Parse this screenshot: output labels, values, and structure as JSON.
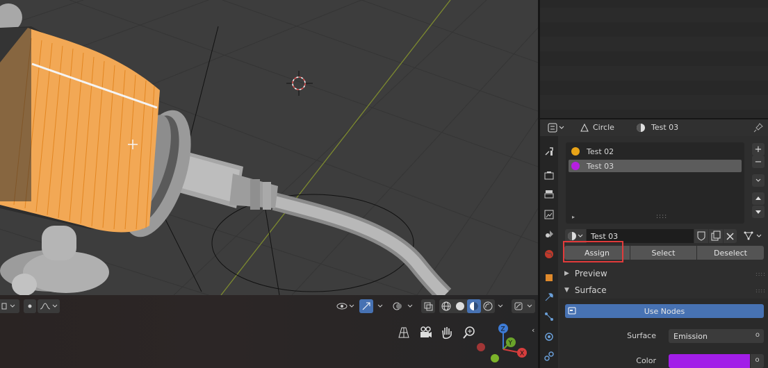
{
  "colors": {
    "viewport_bg": "#3d3d3d",
    "accent_blue": "#4772b3",
    "slot_test02": "#e8a317",
    "slot_test03": "#b61fe0",
    "color_swatch": "#a21ee8",
    "highlight_box": "#e23b3b"
  },
  "props_header": {
    "object_name": "Circle",
    "material_name": "Test 03"
  },
  "material_slots": [
    {
      "name": "Test 02",
      "color": "#e8a317",
      "selected": false
    },
    {
      "name": "Test 03",
      "color": "#b61fe0",
      "selected": true
    }
  ],
  "material_selector": {
    "value": "Test 03"
  },
  "assign_row": {
    "assign": "Assign",
    "select": "Select",
    "deselect": "Deselect"
  },
  "panels": {
    "preview": "Preview",
    "surface": "Surface"
  },
  "surface": {
    "use_nodes": "Use Nodes",
    "surface_label": "Surface",
    "surface_value": "Emission",
    "color_label": "Color"
  },
  "icons": {
    "viewport_toolbar": [
      "object-data-icon",
      "proportional-icon",
      "falloff-icon",
      "visibility-icon",
      "gizmo-icon",
      "overlay-icon",
      "xray-icon",
      "wireframe-shading-icon",
      "solid-shading-icon",
      "material-shading-icon",
      "rendered-shading-icon",
      "editor-type-icon"
    ],
    "navigation": [
      "grid-icon",
      "camera-icon",
      "hand-icon",
      "zoom-icon"
    ]
  }
}
